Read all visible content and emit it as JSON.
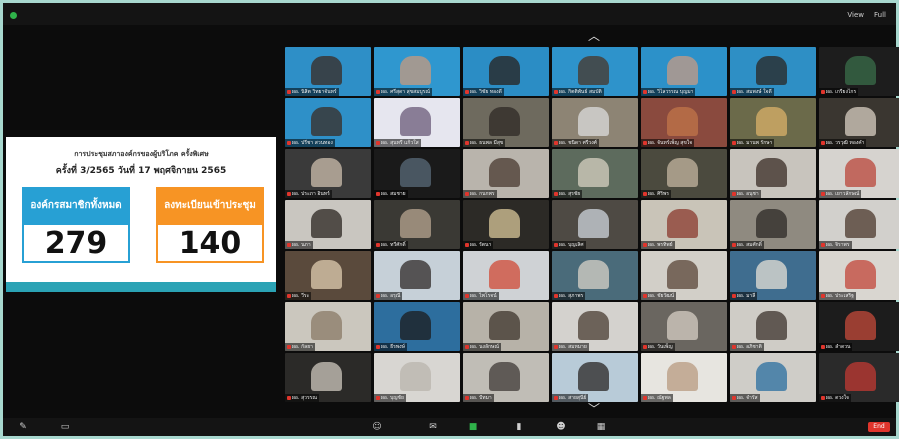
{
  "top_bar": {
    "view_label": "View",
    "full_label": "Full",
    "view_icon": "grid-icon",
    "full_icon": "expand-icon"
  },
  "shared_screen": {
    "title": "การประชุมสภาองค์กรของผู้บริโภค ครั้งพิเศษ",
    "subtitle": "ครั้งที่ 3/2565 วันที่ 17 พฤศจิกายน 2565",
    "stat_total": {
      "label": "องค์กรสมาชิกทั้งหมด",
      "value": "279"
    },
    "stat_registered": {
      "label": "ลงทะเบียนเข้าประชุม",
      "value": "140"
    },
    "colors": {
      "blue": "#27a0d4",
      "orange": "#f79424",
      "teal": "#2ba3b5"
    }
  },
  "gallery": {
    "scroll_up_icon": "chevron-up-icon",
    "scroll_down_icon": "chevron-down-icon",
    "participants": [
      {
        "name": "ผอ. นิสิต วิทยาจันทร์",
        "bg": "#2e8fc7",
        "fg": "#3b2a22"
      },
      {
        "name": "ผอ. ศรีสุดา สุขสมบูรณ์",
        "bg": "#2f97cf",
        "fg": "#c8997d"
      },
      {
        "name": "ผอ. วิชัย ทองดี",
        "bg": "#2b8dc5",
        "fg": "#2a221c"
      },
      {
        "name": "ผอ. กิตติพันธ์ สมบัติ",
        "bg": "#2e93cb",
        "fg": "#4a3528"
      },
      {
        "name": "ผอ. วิไลวรรณ บุญมา",
        "bg": "#2c91c9",
        "fg": "#c79b83"
      },
      {
        "name": "ผอ. สมพงษ์ ใจดี",
        "bg": "#2e8fc5",
        "fg": "#2b2622"
      },
      {
        "name": "ผอ. เกรียงไกร",
        "bg": "#1d1d1d",
        "fg": "#3a6d4a"
      },
      {
        "name": "ผอ. ปรีชา สวนทอง",
        "bg": "#2e90c8",
        "fg": "#3b2c24"
      },
      {
        "name": "ผอ. สุนทรี แก้วใส",
        "bg": "#e6e6ef",
        "fg": "#6a5a78"
      },
      {
        "name": "ผอ. ธนพล มีสุข",
        "bg": "#6e6a5e",
        "fg": "#2f2a26"
      },
      {
        "name": "ผอ. ชนิดา ศรีวงศ์",
        "bg": "#8d8474",
        "fg": "#dcdcdc"
      },
      {
        "name": "ผอ. จันทร์เพ็ญ สุขใจ",
        "bg": "#8a4a3e",
        "fg": "#c0764a"
      },
      {
        "name": "ผอ. มานพ รักษา",
        "bg": "#6b6a4a",
        "fg": "#d9b26a"
      },
      {
        "name": "ผอ. วรวุฒิ ทองคำ",
        "bg": "#3a3630",
        "fg": "#d8cfc2"
      },
      {
        "name": "ผอ. ประภา อินทร์",
        "bg": "#3a3a3a",
        "fg": "#cdbfae"
      },
      {
        "name": "ผอ. สมชาย",
        "bg": "#1a1a1a",
        "fg": "#5a6b7a"
      },
      {
        "name": "ผอ. กนกพร",
        "bg": "#b9b4ac",
        "fg": "#4a3a30"
      },
      {
        "name": "ผอ. สุรชัย",
        "bg": "#5d6b5d",
        "fg": "#d7d0c2"
      },
      {
        "name": "ผอ. ศิริพร",
        "bg": "#4b4a3e",
        "fg": "#c3b6a0"
      },
      {
        "name": "ผอ. อนุชา",
        "bg": "#c8c4bd",
        "fg": "#3a2c25"
      },
      {
        "name": "ผอ. เยาวลักษณ์",
        "bg": "#d6d3cf",
        "fg": "#b9453a"
      },
      {
        "name": "ผอ. นภา",
        "bg": "#c9c6c0",
        "fg": "#2a2420"
      },
      {
        "name": "ผอ. ทวีศักดิ์",
        "bg": "#3a3934",
        "fg": "#b8a690"
      },
      {
        "name": "ผอ. รัตนา",
        "bg": "#2c2a26",
        "fg": "#d8c79a"
      },
      {
        "name": "ผอ. บุญเลิศ",
        "bg": "#4e4a44",
        "fg": "#cfd6dc"
      },
      {
        "name": "ผอ. พรทิพย์",
        "bg": "#c9c4b8",
        "fg": "#8a3a2e"
      },
      {
        "name": "ผอ. สมศักดิ์",
        "bg": "#8f8a80",
        "fg": "#2c2825"
      },
      {
        "name": "ผอ. จิราพร",
        "bg": "#d2d0cc",
        "fg": "#4b382c"
      },
      {
        "name": "ผอ. วีระ",
        "bg": "#5a4a3c",
        "fg": "#e0cdb0"
      },
      {
        "name": "ผอ. อรุณี",
        "bg": "#c6d0d8",
        "fg": "#2f2a28"
      },
      {
        "name": "ผอ. ไพโรจน์",
        "bg": "#cfd2d5",
        "fg": "#d04a35"
      },
      {
        "name": "ผอ. สุภาพร",
        "bg": "#4a6b7a",
        "fg": "#d8d2c8"
      },
      {
        "name": "ผอ. ชัยวัฒน์",
        "bg": "#d2cfc8",
        "fg": "#5a4638"
      },
      {
        "name": "ผอ. มาลี",
        "bg": "#3f6d8f",
        "fg": "#e6e0d6"
      },
      {
        "name": "ผอ. ประเสริฐ",
        "bg": "#d9d6d0",
        "fg": "#c2453a"
      },
      {
        "name": "ผอ. กัลยา",
        "bg": "#cbc7be",
        "fg": "#8a7a66"
      },
      {
        "name": "ผอ. ธีรพงษ์",
        "bg": "#2d6e9e",
        "fg": "#1c1c1c"
      },
      {
        "name": "ผอ. นงลักษณ์",
        "bg": "#b7b2a8",
        "fg": "#3e342c"
      },
      {
        "name": "ผอ. สมหมาย",
        "bg": "#d4d2ce",
        "fg": "#4a3c32"
      },
      {
        "name": "ผอ. วันเพ็ญ",
        "bg": "#6a6660",
        "fg": "#d7cfc4"
      },
      {
        "name": "ผอ. อภิชาติ",
        "bg": "#cfccc6",
        "fg": "#3c332c"
      },
      {
        "name": "ผอ. ลำดวน",
        "bg": "#1c1c1c",
        "fg": "#c44a3a"
      },
      {
        "name": "ผอ. สุวรรณ",
        "bg": "#2b2a28",
        "fg": "#cfc8be"
      },
      {
        "name": "ผอ. บุญชัย",
        "bg": "#d8d6d2",
        "fg": "#b9b4ac"
      },
      {
        "name": "ผอ. ปัทมา",
        "bg": "#c0bdb6",
        "fg": "#3f3a35"
      },
      {
        "name": "ผอ. สายสุนีย์",
        "bg": "#b8cbd8",
        "fg": "#2a2624"
      },
      {
        "name": "ผอ. ณัฐพล",
        "bg": "#e7e5e0",
        "fg": "#b89a80"
      },
      {
        "name": "ผอ. จำรัส",
        "bg": "#cfcdc8",
        "fg": "#2a6ea0"
      },
      {
        "name": "ผอ. ดวงใจ",
        "bg": "#2a2a2a",
        "fg": "#c23a33"
      }
    ]
  },
  "bottom_bar": {
    "controls": [
      {
        "icon": "mute-icon"
      },
      {
        "icon": "video-icon"
      },
      {
        "icon": "participants-icon"
      },
      {
        "icon": "chat-icon"
      },
      {
        "icon": "share-screen-icon"
      },
      {
        "icon": "record-icon"
      },
      {
        "icon": "reactions-icon"
      },
      {
        "icon": "apps-icon"
      }
    ],
    "end_label": "End"
  }
}
